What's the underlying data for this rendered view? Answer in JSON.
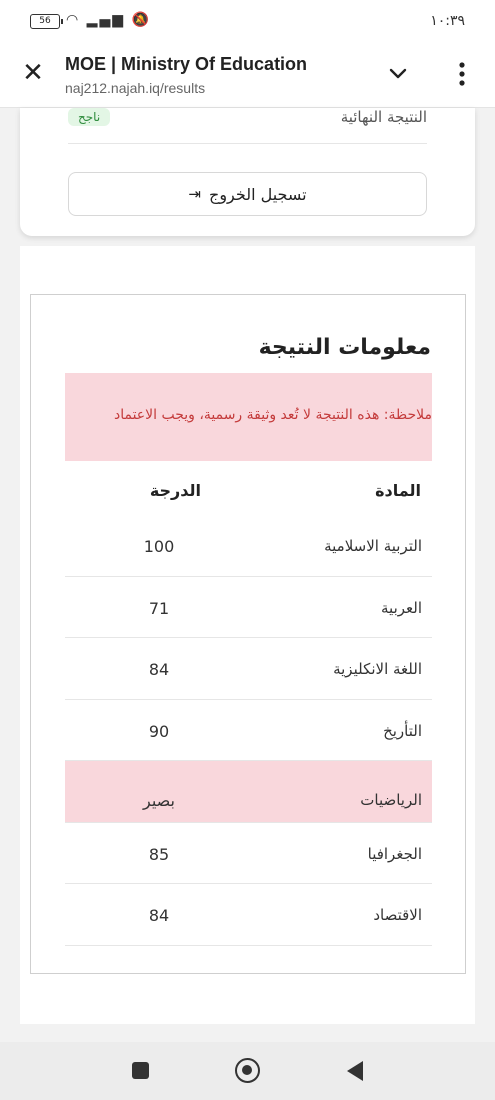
{
  "status": {
    "battery": "56",
    "time": "١٠:٣٩",
    "icons": [
      "wifi-icon",
      "signal-icon",
      "bell-off-icon"
    ]
  },
  "toolbar": {
    "title": "MOE | Ministry Of Education",
    "url": "naj212.najah.iq/results"
  },
  "summary": {
    "final_label": "النتيجة النهائية",
    "final_status": "ناجح",
    "logout_label": "تسجيل الخروج",
    "status_color": "#2e8b3c"
  },
  "results": {
    "title": "معلومات النتيجة",
    "note": "ملاحظة: هذه النتيجة لا تُعد وثيقة رسمية، ويجب الاعتماد",
    "col_subject": "المادة",
    "col_grade": "الدرجة",
    "rows": [
      {
        "subject": "التربية الاسلامية",
        "grade": "100",
        "highlight": false
      },
      {
        "subject": "العربية",
        "grade": "71",
        "highlight": false
      },
      {
        "subject": "اللغة الانكليزية",
        "grade": "84",
        "highlight": false
      },
      {
        "subject": "التأريخ",
        "grade": "90",
        "highlight": false
      },
      {
        "subject": "الرياضيات",
        "grade": "بصير",
        "highlight": true
      },
      {
        "subject": "الجغرافيا",
        "grade": "85",
        "highlight": false
      },
      {
        "subject": "الاقتصاد",
        "grade": "84",
        "highlight": false
      }
    ],
    "highlight_color": "#f9d7dc",
    "note_text_color": "#c43b3b"
  }
}
